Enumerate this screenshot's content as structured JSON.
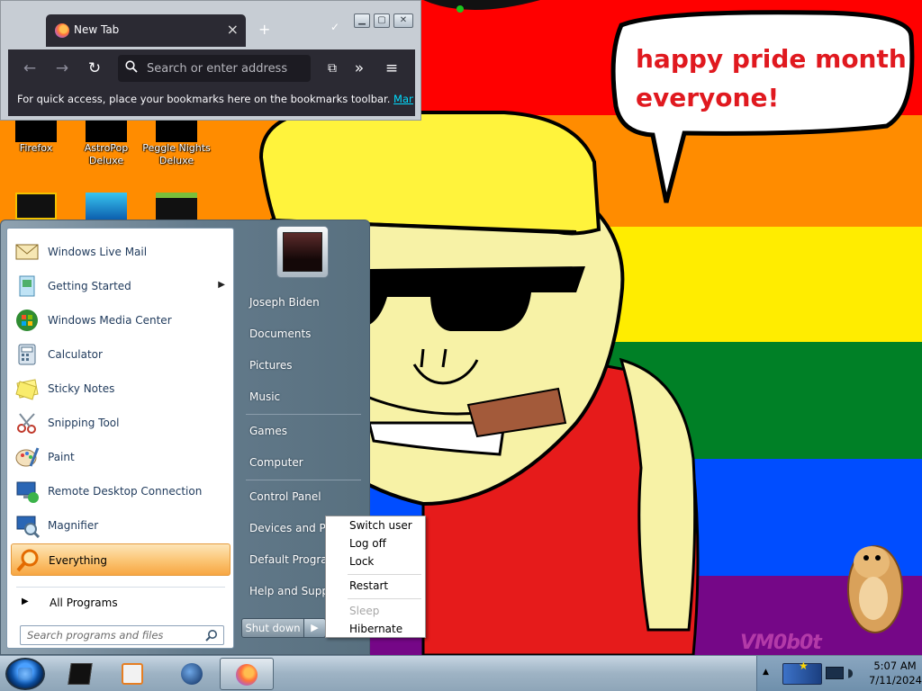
{
  "wallpaper": {
    "speech": [
      "happy pride month",
      "everyone!"
    ],
    "watermark": "VM0b0t",
    "stripe_colors": [
      "#ff0000",
      "#ff8c00",
      "#ffed00",
      "#008026",
      "#004dff",
      "#750787"
    ]
  },
  "desktop_icons": [
    {
      "label": [
        "Firefox"
      ]
    },
    {
      "label": [
        "AstroPop",
        "Deluxe"
      ]
    },
    {
      "label": [
        "Peggle Nights",
        "Deluxe"
      ]
    }
  ],
  "browser": {
    "tab_title": "New Tab",
    "address_placeholder": "Search or enter address",
    "bookmarks_hint": "For quick access, place your bookmarks here on the bookmarks toolbar.",
    "bookmarks_link": "Manage bo"
  },
  "start_menu": {
    "programs": [
      {
        "label": "Windows Live Mail",
        "icon": "mail-icon"
      },
      {
        "label": "Getting Started",
        "icon": "getting-started-icon",
        "submenu": true
      },
      {
        "label": "Windows Media Center",
        "icon": "media-center-icon"
      },
      {
        "label": "Calculator",
        "icon": "calculator-icon"
      },
      {
        "label": "Sticky Notes",
        "icon": "sticky-notes-icon"
      },
      {
        "label": "Snipping Tool",
        "icon": "snipping-tool-icon"
      },
      {
        "label": "Paint",
        "icon": "paint-icon"
      },
      {
        "label": "Remote Desktop Connection",
        "icon": "remote-desktop-icon"
      },
      {
        "label": "Magnifier",
        "icon": "magnifier-icon"
      },
      {
        "label": "Everything",
        "icon": "everything-icon",
        "selected": true
      }
    ],
    "all_programs": "All Programs",
    "search_placeholder": "Search programs and files",
    "right_links": [
      "Joseph Biden",
      "Documents",
      "Pictures",
      "Music",
      "Games",
      "Computer",
      "Control Panel",
      "Devices and Printers",
      "Default Programs",
      "Help and Support"
    ],
    "shutdown_label": "Shut down"
  },
  "shutdown_menu": {
    "items": [
      {
        "label": "Switch user",
        "enabled": true
      },
      {
        "label": "Log off",
        "enabled": true
      },
      {
        "label": "Lock",
        "enabled": true
      },
      {
        "label": "Restart",
        "enabled": true
      },
      {
        "label": "Sleep",
        "enabled": false
      },
      {
        "label": "Hibernate",
        "enabled": true
      }
    ]
  },
  "taskbar": {
    "clock_time": "5:07 AM",
    "clock_date": "7/11/2024"
  }
}
